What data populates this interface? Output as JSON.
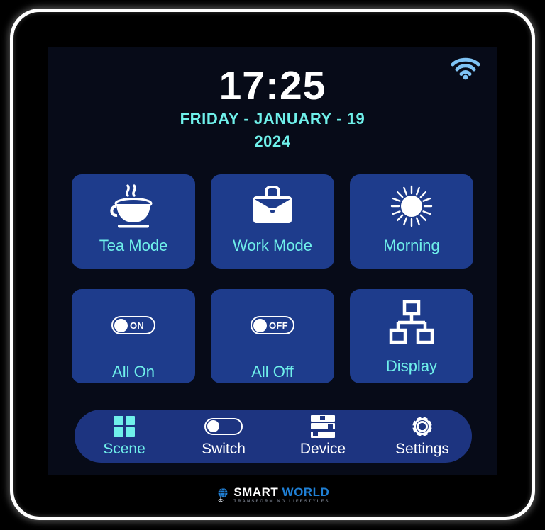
{
  "device": {
    "bezel_color": "#ffffff",
    "chassis_color": "#000000",
    "screen_bg": "#070b18"
  },
  "theme": {
    "tile_blue": "#1e3c8c",
    "nav_blue": "#1d3480",
    "accent_cyan": "#6ff0ea",
    "wifi_blue": "#7fc4f5",
    "icon_white": "#ffffff"
  },
  "status_bar": {
    "wifi_icon": "wifi-icon",
    "wifi_state": "connected"
  },
  "clock": {
    "time": "17:25",
    "date_line1": "FRIDAY - JANUARY - 19",
    "date_line2": "2024"
  },
  "scenes": {
    "tiles": [
      {
        "id": "tea-mode",
        "label": "Tea Mode",
        "icon": "tea-cup-icon",
        "row": 1
      },
      {
        "id": "work-mode",
        "label": "Work Mode",
        "icon": "briefcase-icon",
        "row": 1
      },
      {
        "id": "morning",
        "label": "Morning",
        "icon": "sun-icon",
        "row": 1
      },
      {
        "id": "all-on",
        "label": "All On",
        "icon": "toggle-on-icon",
        "row": 2,
        "toggle_text": "ON"
      },
      {
        "id": "all-off",
        "label": "All Off",
        "icon": "toggle-off-icon",
        "row": 2,
        "toggle_text": "OFF"
      },
      {
        "id": "display",
        "label": "Display",
        "icon": "hierarchy-icon",
        "row": 2
      }
    ]
  },
  "nav": {
    "items": [
      {
        "id": "scene",
        "label": "Scene",
        "icon": "grid-icon",
        "active": true
      },
      {
        "id": "switch",
        "label": "Switch",
        "icon": "toggle-icon",
        "active": false
      },
      {
        "id": "device",
        "label": "Device",
        "icon": "server-icon",
        "active": false
      },
      {
        "id": "settings",
        "label": "Settings",
        "icon": "gear-icon",
        "active": false
      }
    ]
  },
  "brand": {
    "word1": "SMART",
    "word2": "WORLD",
    "tagline": "TRANSFORMING LIFESTYLES",
    "globe_icon": "globe-wifi-icon"
  }
}
